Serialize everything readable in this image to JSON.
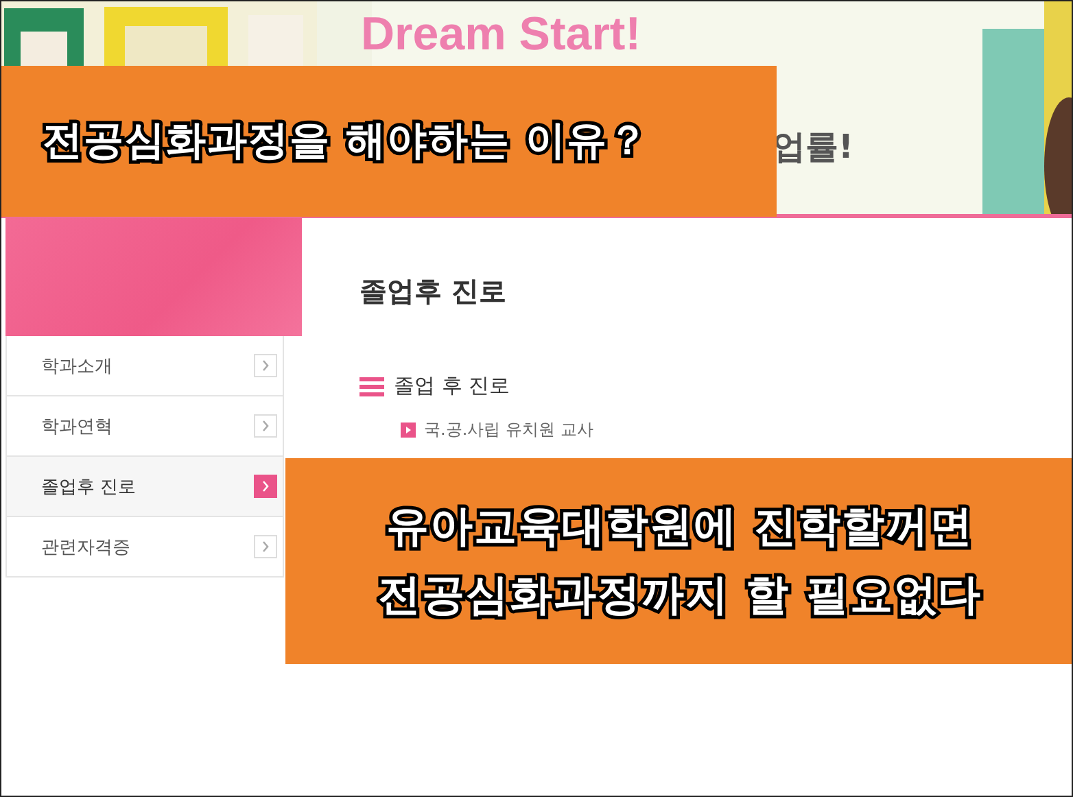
{
  "header": {
    "title": "Dream Start!",
    "subtitle": "업률!"
  },
  "sidebar": {
    "items": [
      {
        "label": "학과소개",
        "selected": false
      },
      {
        "label": "학과연혁",
        "selected": false
      },
      {
        "label": "졸업후 진로",
        "selected": true
      },
      {
        "label": "관련자격증",
        "selected": false
      }
    ]
  },
  "content": {
    "title": "졸업후 진로",
    "section": "졸업 후 진로",
    "bullets": [
      "국.공.사립 유치원 교사"
    ]
  },
  "captions": [
    {
      "lines": [
        "전공심화과정을 해야하는 이유？"
      ]
    },
    {
      "lines": [
        "유아교육대학원에 진학할꺼면",
        "전공심화과정까지 할 필요없다"
      ]
    }
  ]
}
